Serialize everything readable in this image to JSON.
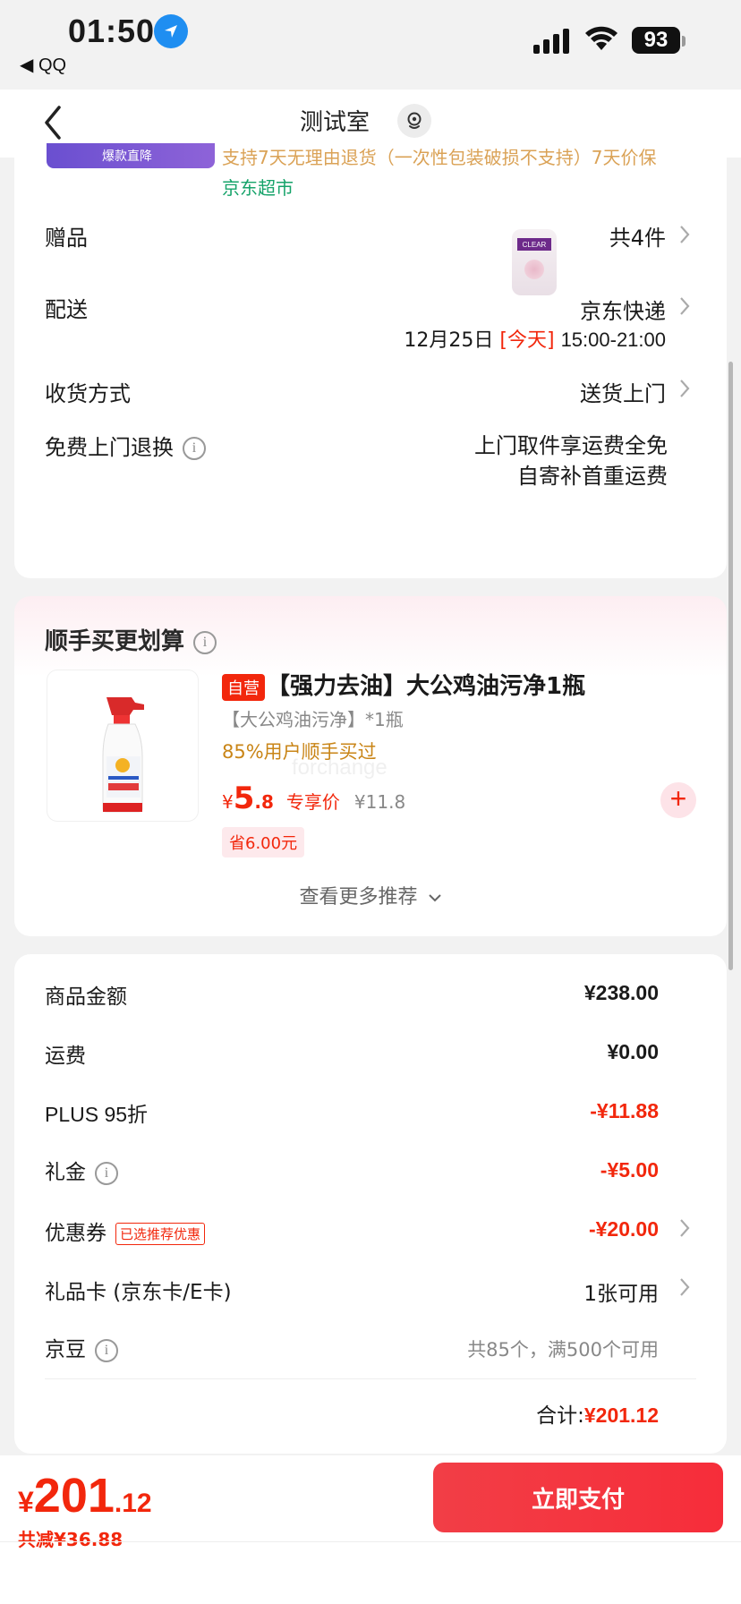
{
  "status_bar": {
    "time": "01:50",
    "back_app": "◀ QQ",
    "battery": "93",
    "icons": [
      "location-arrow-icon",
      "signal-icon",
      "wifi-icon",
      "battery-icon"
    ]
  },
  "nav": {
    "title": "测试室",
    "back_icon": "chevron-left-icon",
    "pin_icon": "location-pin-icon"
  },
  "top_card": {
    "banner_label": "爆款直降",
    "cut_text": "支持7天无理由退货（一次性包装破损不支持）7天价保",
    "store": "京东超市",
    "rows": {
      "gift_label": "赠品",
      "gift_value": "共4件",
      "gift_image_text": "CLEAR",
      "delivery_label": "配送",
      "delivery_value": "京东快递",
      "delivery_date": "12月25日",
      "delivery_today": "[今天]",
      "delivery_time": "15:00-21:00",
      "receive_label": "收货方式",
      "receive_value": "送货上门",
      "return_label": "免费上门退换",
      "return_line1": "上门取件享运费全免",
      "return_line2": "自寄补首重运费"
    }
  },
  "recommend": {
    "title": "顺手买更划算",
    "product": {
      "tag": "自营",
      "name": "【强力去油】大公鸡油污净1瓶",
      "spec": "【大公鸡油污净】*1瓶",
      "stat": "85%用户顺手买过",
      "price_symbol": "¥",
      "price_int": "5",
      "price_dec": ".8",
      "price_label": "专享价",
      "original_price": "¥11.8",
      "save": "省6.00元"
    },
    "watermark": "forchange",
    "more": "查看更多推荐"
  },
  "summary": {
    "rows": [
      {
        "label": "商品金额",
        "value": "¥238.00"
      },
      {
        "label": "运费",
        "value": "¥0.00"
      },
      {
        "label": "PLUS 95折",
        "value": "-¥11.88"
      },
      {
        "label": "礼金",
        "value": "-¥5.00"
      },
      {
        "label": "优惠券",
        "tag": "已选推荐优惠",
        "value": "-¥20.00"
      },
      {
        "label": "礼品卡 (京东卡/E卡)",
        "value": "1张可用"
      },
      {
        "label": "京豆",
        "value": "共85个，满500个可用"
      }
    ],
    "total_label": "合计:",
    "total_value": "¥201.12"
  },
  "bottom_bar": {
    "price_symbol": "¥",
    "price_int": "201",
    "price_dec": ".12",
    "saved": "共减¥36.88",
    "pay_label": "立即支付"
  },
  "colors": {
    "accent_red": "#f2270c",
    "store_green": "#16a36a",
    "stat_orange": "#c98517"
  }
}
